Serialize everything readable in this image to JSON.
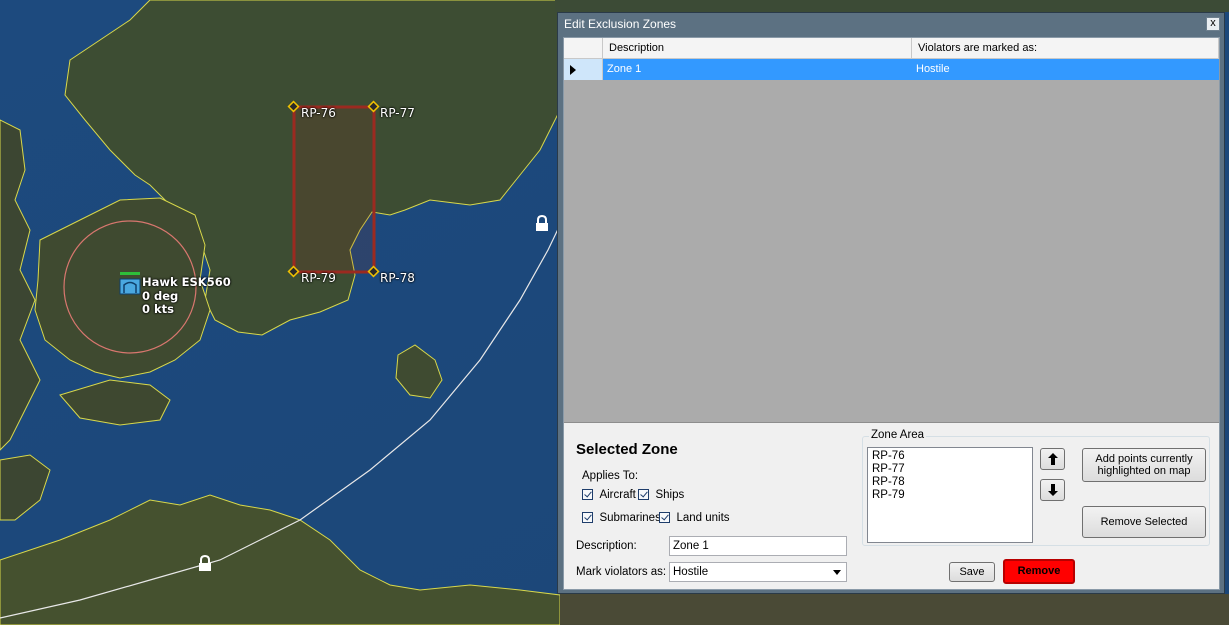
{
  "map": {
    "reference_points": [
      {
        "label": "RP-76"
      },
      {
        "label": "RP-77"
      },
      {
        "label": "RP-79"
      },
      {
        "label": "RP-78"
      }
    ],
    "unit": {
      "name": "Hawk ESK560",
      "heading": "0 deg",
      "speed": "0 kts"
    },
    "lock_icon": "lock-icon"
  },
  "window": {
    "title": "Edit Exclusion Zones",
    "close_label": "x",
    "grid": {
      "headers": [
        "Description",
        "Violators are marked as:"
      ],
      "rows": [
        {
          "description": "Zone 1",
          "violators": "Hostile",
          "selected": true
        }
      ]
    },
    "selected_zone": {
      "heading": "Selected Zone",
      "applies_to_label": "Applies To:",
      "checkboxes": [
        {
          "label": "Aircraft",
          "checked": true
        },
        {
          "label": "Ships",
          "checked": true
        },
        {
          "label": "Submarines",
          "checked": true
        },
        {
          "label": "Land units",
          "checked": true
        }
      ],
      "description_label": "Description:",
      "description_value": "Zone 1",
      "mark_violators_label": "Mark violators as:",
      "mark_violators_value": "Hostile"
    },
    "zone_area": {
      "label": "Zone Area",
      "points": [
        "RP-76",
        "RP-77",
        "RP-78",
        "RP-79"
      ],
      "add_points_label": "Add points currently highlighted on map",
      "remove_selected_label": "Remove Selected"
    },
    "save_label": "Save",
    "remove_label": "Remove",
    "colors": {
      "selection": "#3399ff",
      "remove_button": "#ff0000",
      "zone_outline": "#9b2a20"
    }
  }
}
